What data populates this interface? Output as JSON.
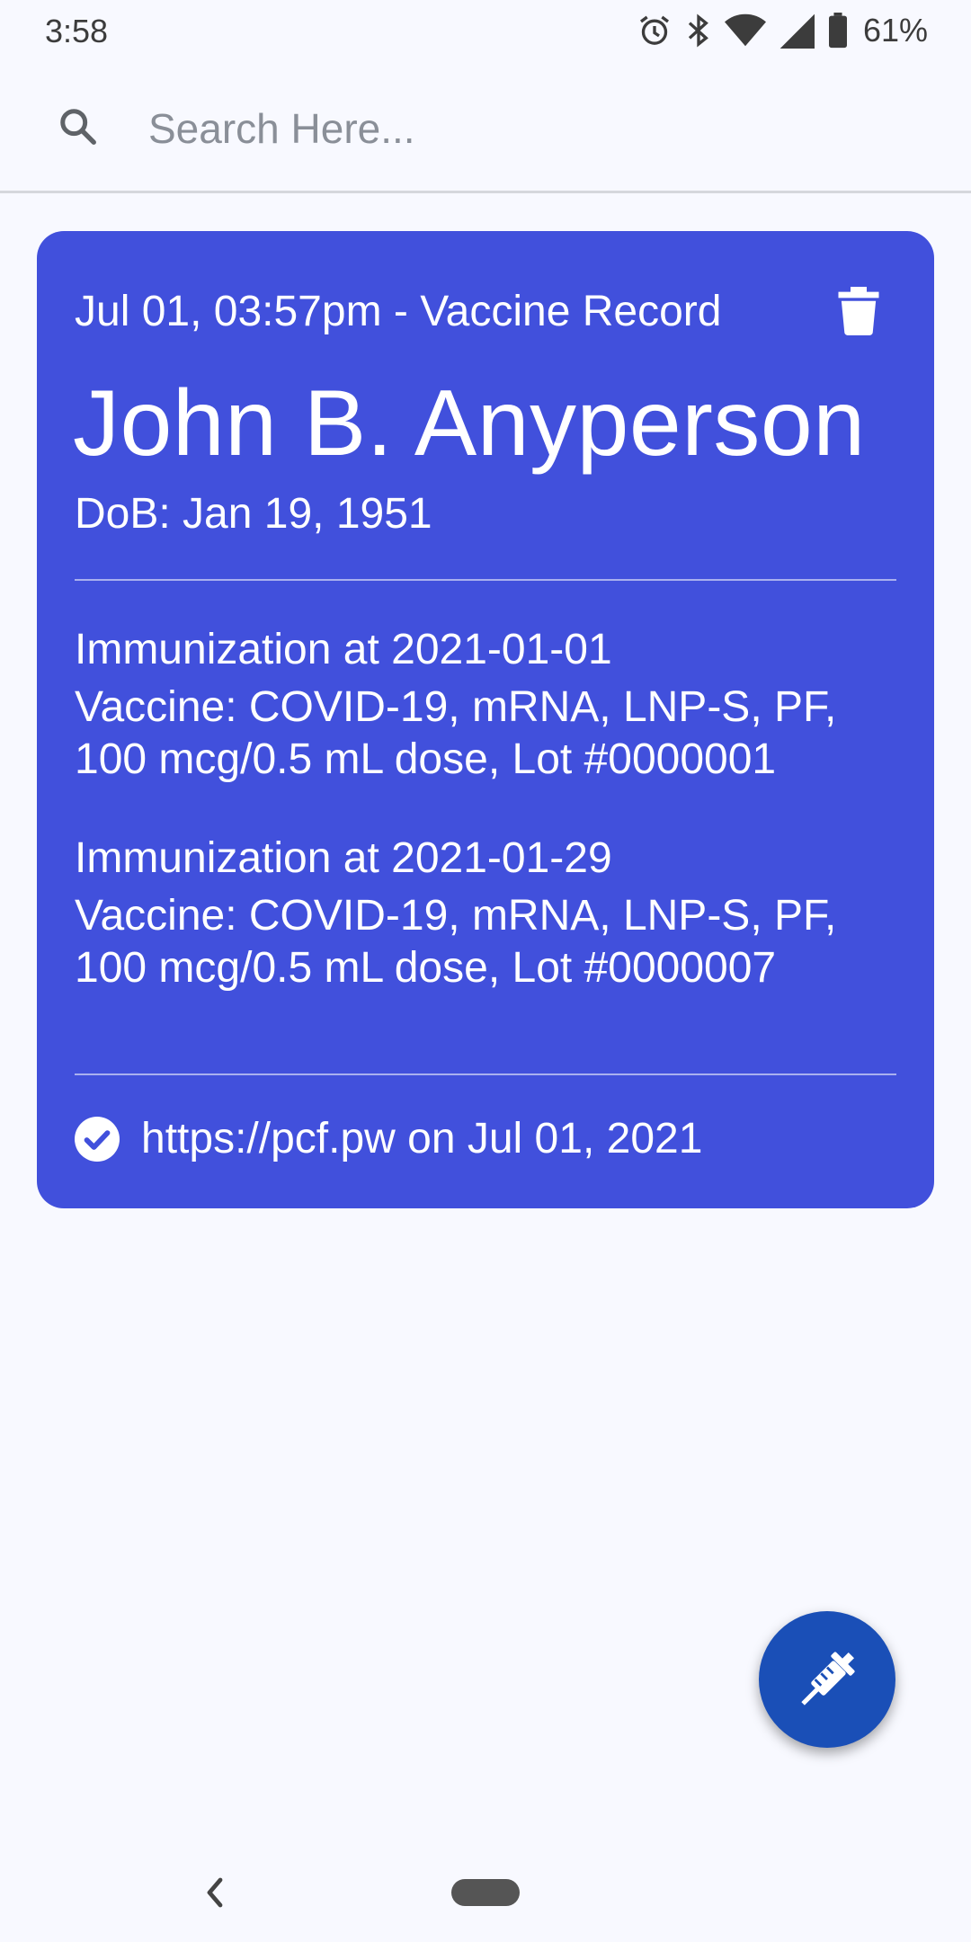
{
  "status_bar": {
    "time": "3:58",
    "battery_percent": "61%",
    "icons": [
      "alarm-icon",
      "bluetooth-icon",
      "wifi-icon",
      "signal-icon",
      "battery-icon"
    ]
  },
  "search": {
    "placeholder": "Search Here...",
    "value": ""
  },
  "colors": {
    "card_background": "#4150dc",
    "fab_background": "#1a4fb7",
    "page_background": "#f8f9ff"
  },
  "record": {
    "header": "Jul 01, 03:57pm - Vaccine Record",
    "name": "John B. Anyperson",
    "dob": "DoB: Jan 19, 1951",
    "immunizations": [
      {
        "title": "Immunization at 2021-01-01",
        "vaccine_line1": "Vaccine: COVID-19, mRNA, LNP-S, PF,",
        "vaccine_line2": "100 mcg/0.5 mL dose, Lot #0000001"
      },
      {
        "title": "Immunization at 2021-01-29",
        "vaccine_line1": "Vaccine: COVID-19, mRNA, LNP-S, PF,",
        "vaccine_line2": "100 mcg/0.5 mL dose, Lot #0000007"
      }
    ],
    "verification": "https://pcf.pw on Jul 01, 2021"
  },
  "fab": {
    "icon": "syringe-icon"
  },
  "nav": {
    "icons": [
      "back-icon",
      "home-pill"
    ]
  }
}
